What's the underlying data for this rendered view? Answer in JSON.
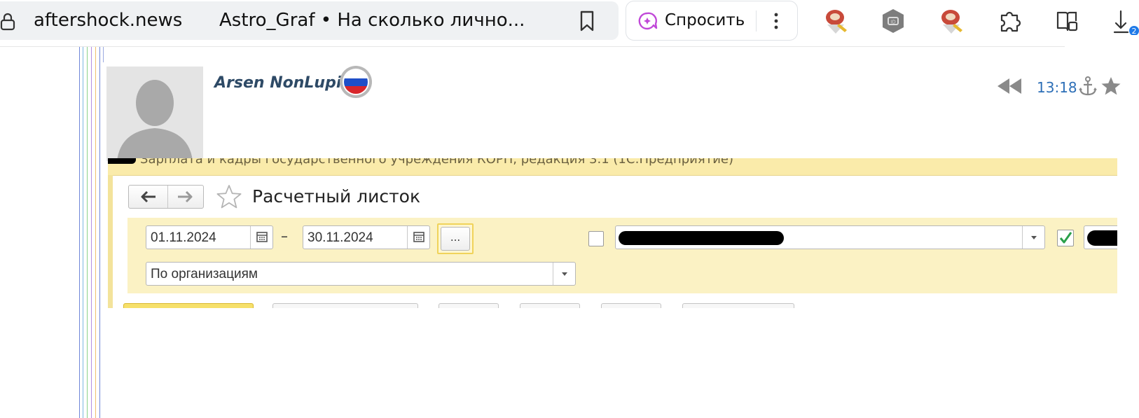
{
  "browser": {
    "domain": "aftershock.news",
    "tab_title": "Astro_Graf • На сколько лично...",
    "ask_label": "Спросить",
    "downloads_badge": "2",
    "icons": [
      "lock-icon",
      "bookmark-icon",
      "ai-ask-icon",
      "more-vert-icon",
      "extension-stamp-icon",
      "extension-id-icon",
      "extension-stamp-icon",
      "extensions-puzzle-icon",
      "reading-mode-icon",
      "download-icon"
    ]
  },
  "post": {
    "author": "Arsen NonLupin",
    "time": "13:18",
    "flag": "russia-flag",
    "colors": {
      "author": "#2e4a66",
      "time": "#2d6fb7"
    }
  },
  "screenshot": {
    "app_title": "Зарплата и кадры государственного учреждения КОРП, редакция 3.1   (1С:Предприятие)",
    "form_title": "Расчетный листок",
    "date_from": "01.11.2024",
    "date_separator": "–",
    "date_to": "30.11.2024",
    "period_button": "...",
    "grouping": "По организациям",
    "colors": {
      "title_bar": "#faebaa",
      "panel": "#fbf2c4",
      "check": "#2aa04a"
    }
  }
}
